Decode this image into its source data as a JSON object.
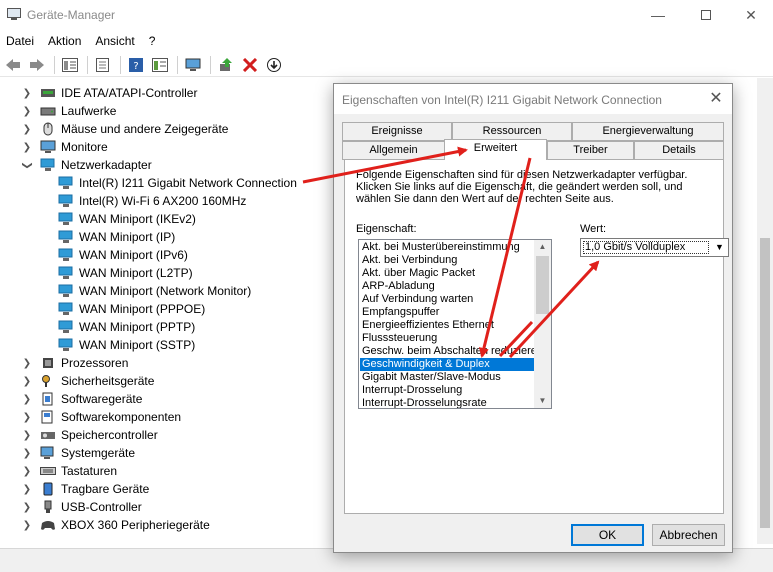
{
  "window": {
    "title": "Geräte-Manager"
  },
  "menu": [
    "Datei",
    "Aktion",
    "Ansicht",
    "?"
  ],
  "toolbar_icons": [
    "back-icon",
    "forward-icon",
    "properties-grid-icon",
    "list-icon",
    "help-icon",
    "view-icon",
    "monitor-icon",
    "update-driver-icon",
    "uninstall-icon",
    "download-icon"
  ],
  "tree": {
    "categories_top": [
      {
        "label": "IDE ATA/ATAPI-Controller",
        "icon": "ide-controller-icon"
      },
      {
        "label": "Laufwerke",
        "icon": "drive-icon"
      },
      {
        "label": "Mäuse und andere Zeigegeräte",
        "icon": "mouse-icon"
      },
      {
        "label": "Monitore",
        "icon": "monitor-icon"
      }
    ],
    "network": {
      "label": "Netzwerkadapter",
      "children": [
        "Intel(R) I211 Gigabit Network Connection",
        "Intel(R) Wi-Fi 6 AX200 160MHz",
        "WAN Miniport (IKEv2)",
        "WAN Miniport (IP)",
        "WAN Miniport (IPv6)",
        "WAN Miniport (L2TP)",
        "WAN Miniport (Network Monitor)",
        "WAN Miniport (PPPOE)",
        "WAN Miniport (PPTP)",
        "WAN Miniport (SSTP)"
      ]
    },
    "categories_bottom": [
      {
        "label": "Prozessoren",
        "icon": "processor-icon"
      },
      {
        "label": "Sicherheitsgeräte",
        "icon": "security-key-icon"
      },
      {
        "label": "Softwaregeräte",
        "icon": "software-device-icon"
      },
      {
        "label": "Softwarekomponenten",
        "icon": "software-component-icon"
      },
      {
        "label": "Speichercontroller",
        "icon": "storage-controller-icon"
      },
      {
        "label": "Systemgeräte",
        "icon": "system-device-icon"
      },
      {
        "label": "Tastaturen",
        "icon": "keyboard-icon"
      },
      {
        "label": "Tragbare Geräte",
        "icon": "portable-device-icon"
      },
      {
        "label": "USB-Controller",
        "icon": "usb-icon"
      },
      {
        "label": "XBOX 360 Peripheriegeräte",
        "icon": "gamepad-icon"
      }
    ]
  },
  "dialog": {
    "title": "Eigenschaften von Intel(R) I211 Gigabit Network Connection",
    "tabs_row1": [
      "Ereignisse",
      "Ressourcen",
      "Energieverwaltung"
    ],
    "tabs_row2": [
      "Allgemein",
      "Erweitert",
      "Treiber",
      "Details"
    ],
    "active_tab": "Erweitert",
    "description": "Folgende Eigenschaften sind für diesen Netzwerkadapter verfügbar. Klicken Sie links auf die Eigenschaft, die geändert werden soll, und wählen Sie dann den Wert auf der rechten Seite aus.",
    "property_label": "Eigenschaft:",
    "value_label": "Wert:",
    "properties": [
      "Akt. bei Musterübereinstimmung",
      "Akt. bei Verbindung",
      "Akt. über Magic Packet",
      "ARP-Abladung",
      "Auf Verbindung warten",
      "Empfangspuffer",
      "Energieeffizientes Ethernet",
      "Flusssteuerung",
      "Geschw. beim Abschalten reduzieren",
      "Geschwindigkeit & Duplex",
      "Gigabit Master/Slave-Modus",
      "Interrupt-Drosselung",
      "Interrupt-Drosselungsrate"
    ],
    "selected_property": "Geschwindigkeit & Duplex",
    "value": "1,0 Gbit/s Vollduplex",
    "ok_label": "OK",
    "cancel_label": "Abbrechen"
  },
  "colors": {
    "selection": "#0078d7",
    "arrow": "#e0201b",
    "network_icon": "#2f9bd6"
  }
}
